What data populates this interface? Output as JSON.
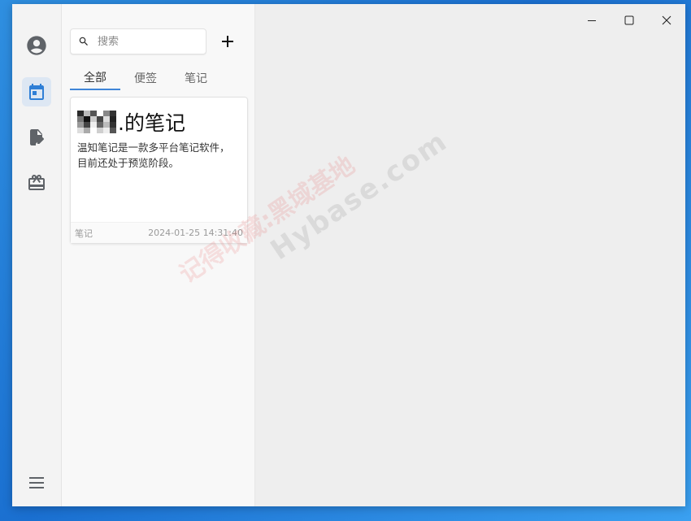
{
  "rail": {
    "items": [
      {
        "name": "account",
        "icon": "account-circle-icon"
      },
      {
        "name": "calendar",
        "icon": "calendar-icon"
      },
      {
        "name": "note-edit",
        "icon": "note-edit-icon"
      },
      {
        "name": "gift",
        "icon": "gift-icon"
      }
    ],
    "menu_icon": "hamburger-menu-icon"
  },
  "search": {
    "placeholder": "搜索"
  },
  "tabs": [
    {
      "label": "全部",
      "active": true
    },
    {
      "label": "便签",
      "active": false
    },
    {
      "label": "笔记",
      "active": false
    }
  ],
  "card": {
    "title": ".的笔记",
    "body": "温知笔记是一款多平台笔记软件，目前还处于预览阶段。",
    "type": "笔记",
    "timestamp": "2024-01-25 14:31:40"
  },
  "watermark": {
    "line1": "记得收藏:黑域基地",
    "line2": "Hybase.com"
  },
  "colors": {
    "accent": "#3f85d8",
    "active_rail_bg": "#dde7f3",
    "icon_gray": "#5f6368"
  }
}
